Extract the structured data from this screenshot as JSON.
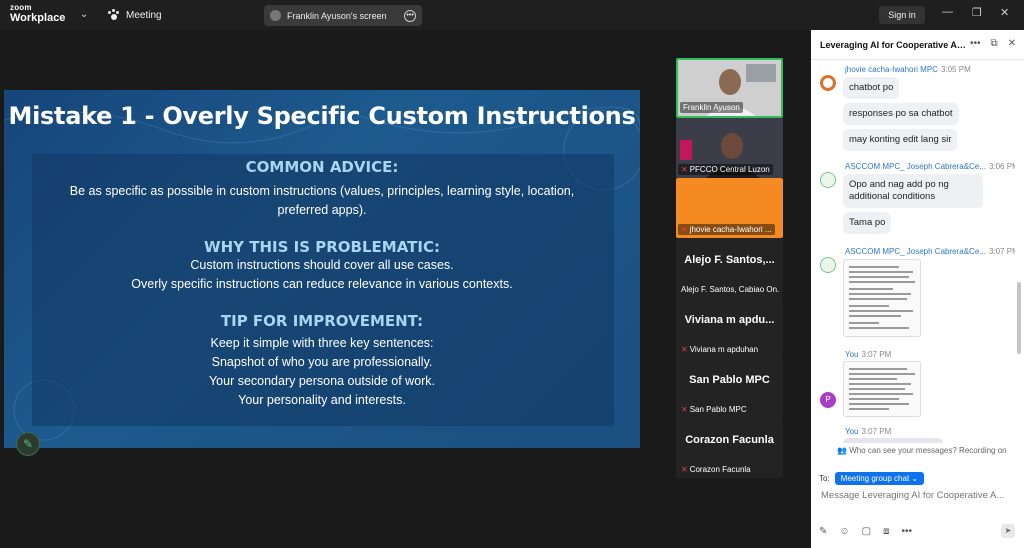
{
  "app": {
    "brand_top": "zoom",
    "brand_bottom": "Workplace",
    "meeting_label": "Meeting",
    "screen_share_label": "Franklin Ayuson's screen",
    "sign_in": "Sign in"
  },
  "slide": {
    "title": "Mistake 1 - Overly Specific Custom Instructions",
    "sections": [
      {
        "heading": "COMMON ADVICE:",
        "lines": [
          "Be as specific as possible in custom instructions (values, principles, learning style, location,",
          "preferred apps)."
        ]
      },
      {
        "heading": "WHY THIS IS PROBLEMATIC:",
        "lines": [
          "Custom instructions should cover all use cases.",
          "Overly specific instructions can reduce relevance in various contexts."
        ]
      },
      {
        "heading": "TIP FOR IMPROVEMENT:",
        "lines": [
          "Keep it simple with three key sentences:",
          "Snapshot of who you are professionally.",
          "Your secondary persona outside of work.",
          "Your personality and interests."
        ]
      }
    ]
  },
  "participants": [
    {
      "name": "Franklin Ayuson",
      "big": ""
    },
    {
      "name": "PFCCO Central Luzon",
      "big": ""
    },
    {
      "name": "jhovie cacha-Iwahori ...",
      "big": ""
    },
    {
      "name": "Alejo F. Santos, Cabiao On...",
      "big": "Alejo F. Santos,..."
    },
    {
      "name": "Viviana m apduhan",
      "big": "Viviana m apdu..."
    },
    {
      "name": "San Pablo MPC",
      "big": "San Pablo MPC"
    },
    {
      "name": "Corazon Facunla",
      "big": "Corazon Facunla"
    }
  ],
  "chat": {
    "title": "Leveraging AI for Cooperative Ad...",
    "messages": [
      {
        "sender": "jhovie cacha-Iwahori MPC",
        "time": "3:05 PM",
        "bubbles": [
          "chatbot po",
          "responses po sa chatbot",
          "may konting edit lang sir"
        ]
      },
      {
        "sender": "ASCCOM MPC_ Joseph Cabrera&Ce...",
        "time": "3:06 PM",
        "bubbles": [
          "Opo and nag add po ng additional conditions",
          "Tama po"
        ]
      },
      {
        "sender": "ASCCOM MPC_ Joseph Cabrera&Ce...",
        "time": "3:07 PM",
        "bubbles": []
      },
      {
        "sender": "You",
        "time": "3:07 PM",
        "bubbles": []
      },
      {
        "sender": "You",
        "time": "3:07 PM",
        "bubbles": []
      }
    ],
    "you_initial": "P",
    "visibility_notice": "Who can see your messages? Recording on",
    "to_label": "To:",
    "recipient": "Meeting group chat",
    "input_placeholder": "Message Leveraging AI for Cooperative A..."
  },
  "colors": {
    "accent": "#0e72ed",
    "slide_heading": "#a9d4f2",
    "active_speaker": "#2fbf5a",
    "orange_tile": "#f58a22"
  }
}
